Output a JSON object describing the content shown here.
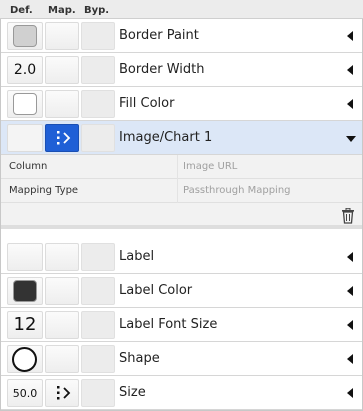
{
  "header": {
    "def": "Def.",
    "map": "Map.",
    "byp": "Byp."
  },
  "rows": [
    {
      "label": "Border Paint",
      "def_type": "swatch",
      "def_color": "#d0d0d0"
    },
    {
      "label": "Border Width",
      "def_type": "number",
      "def_value": "2.0"
    },
    {
      "label": "Fill Color",
      "def_type": "swatch",
      "def_color": "#ffffff"
    },
    {
      "label": "Image/Chart 1",
      "def_type": "empty",
      "mapping": "passthrough",
      "expanded": true,
      "selected": true
    },
    {
      "label": "Label",
      "def_type": "empty"
    },
    {
      "label": "Label Color",
      "def_type": "swatch",
      "def_color": "#333333"
    },
    {
      "label": "Label Font Size",
      "def_type": "number",
      "def_value": "12"
    },
    {
      "label": "Shape",
      "def_type": "ellipse"
    },
    {
      "label": "Size",
      "def_type": "number",
      "def_value": "50.0",
      "mapping": "passthrough"
    }
  ],
  "mapping_details": {
    "column_label": "Column",
    "column_value": "Image URL",
    "mapping_type_label": "Mapping Type",
    "mapping_type_value": "Passthrough Mapping"
  },
  "colors": {
    "accent": "#1f5fd6",
    "selected_row": "#dce7f7"
  },
  "icons": {
    "delete": "trash-icon",
    "mapping": "passthrough-mapping-icon"
  }
}
